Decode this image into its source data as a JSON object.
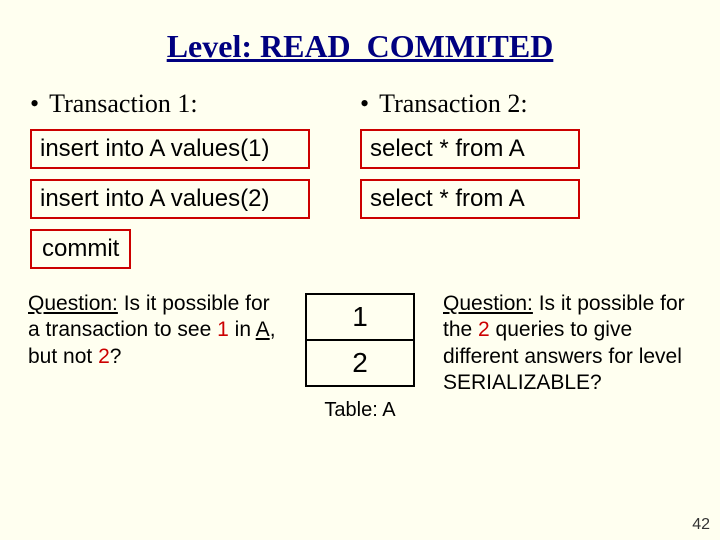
{
  "title": "Level: READ_COMMITED",
  "left": {
    "heading": "Transaction 1:",
    "rows": [
      "insert into A values(1)",
      "insert into A values(2)"
    ]
  },
  "right": {
    "heading": "Transaction 2:",
    "rows": [
      "select * from A",
      "select * from A"
    ]
  },
  "commit": "commit",
  "q1": {
    "label": "Question:",
    "p1": " Is it possible for a transaction to see ",
    "hl1": "1",
    "p2": " in ",
    "ul1": "A",
    "p3": ", but not ",
    "hl2": "2",
    "p4": "?"
  },
  "table": {
    "rows": [
      "1",
      "2"
    ],
    "caption": "Table: A"
  },
  "q2": {
    "label": "Question:",
    "p1": " Is it possible for the ",
    "hl1": "2",
    "p2": " queries to give different answers for level SERIALIZABLE?"
  },
  "slide_num": "42",
  "chart_data": {
    "type": "table",
    "title": "Table: A",
    "columns": [
      "value"
    ],
    "rows": [
      [
        1
      ],
      [
        2
      ]
    ]
  }
}
